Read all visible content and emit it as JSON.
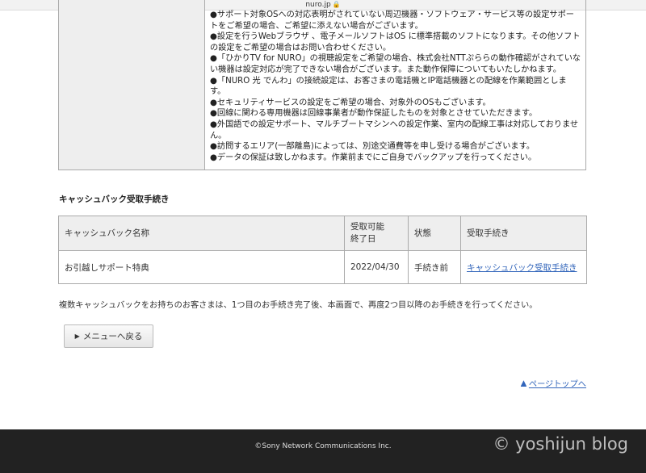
{
  "browser": {
    "url": "nuro.jp"
  },
  "notes": [
    "●サポート対象OSへの対応表明がされていない周辺機器・ソフトウェア・サービス等の設定サポートをご希望の場合、ご希望に添えない場合がございます。",
    "●設定を行うWebブラウザ 、電子メールソフトはOS に標準搭載のソフトになります。その他ソフトの設定をご希望の場合はお問い合わせください。",
    "●「ひかりTV for NURO」の視聴設定をご希望の場合、株式会社NTTぷららの動作確認がされていない機器は設定対応が完了できない場合がございます。また動作保障についてもいたしかねます。",
    "●「NURO 光 でんわ」の接続設定は、お客さまの電話機とIP電話機器との配線を作業範囲とします。",
    "●セキュリティサービスの設定をご希望の場合、対象外のOSもございます。",
    "●回線に関わる専用機器は回線事業者が動作保証したものを対象とさせていただきます。",
    "●外国語での設定サポート、マルチブートマシンへの設定作業、室内の配線工事は対応しておりません。",
    "●訪問するエリア(一部離島)によっては、別途交通費等を申し受ける場合がございます。",
    "●データの保証は致しかねます。作業前までにご自身でバックアップを行ってください。"
  ],
  "cashback": {
    "section_title": "キャッシュバック受取手続き",
    "headers": {
      "name": "キャッシュバック名称",
      "deadline_1": "受取可能",
      "deadline_2": "終了日",
      "status": "状態",
      "procedure": "受取手続き"
    },
    "row": {
      "name": "お引越しサポート特典",
      "deadline": "2022/04/30",
      "status": "手続き前",
      "link": "キャッシュバック受取手続き"
    },
    "note": "複数キャッシュバックをお持ちのお客さまは、1つ目のお手続き完了後、本画面で、再度2つ目以降のお手続きを行ってください。"
  },
  "menu_button": {
    "label": "メニューへ戻る",
    "icon": "triangle-right-icon"
  },
  "page_top": {
    "label": "ページトップへ",
    "icon": "triangle-up-icon"
  },
  "footer": {
    "copyright": "©Sony Network Communications Inc.",
    "watermark": "© yoshijun blog"
  },
  "colors": {
    "link": "#3366bb",
    "footer_bg": "#222222",
    "header_bg": "#eeeeee"
  }
}
